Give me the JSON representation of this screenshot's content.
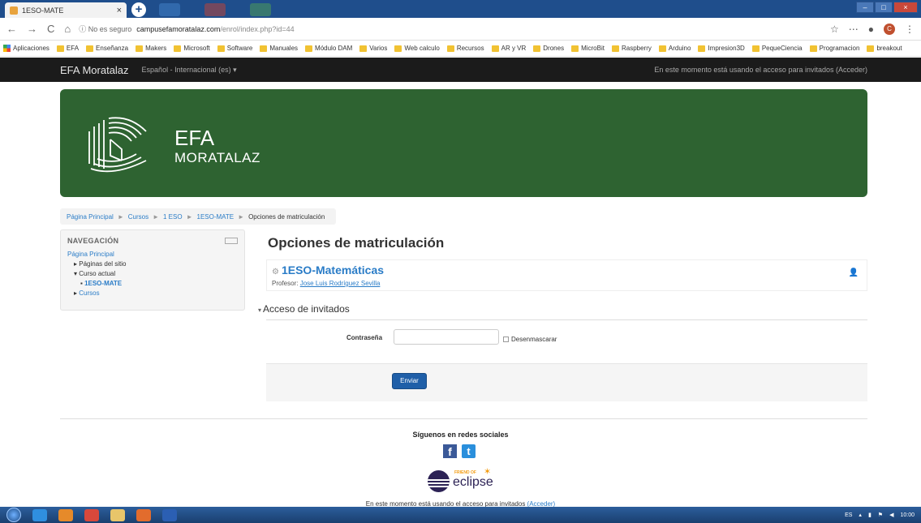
{
  "browser": {
    "tab_title": "1ESO-MATE",
    "tab_close": "×",
    "new_tab": "+",
    "nav_back": "←",
    "nav_forward": "→",
    "nav_reload": "C",
    "nav_home": "⌂",
    "security": "ⓘ No es seguro",
    "url_host": "campusefamoratalaz.com",
    "url_path": "/enrol/index.php?id=44",
    "profile_initial": "C",
    "bookmarks": [
      "Aplicaciones",
      "EFA",
      "Enseñanza",
      "Makers",
      "Microsoft",
      "Software",
      "Manuales",
      "Módulo DAM",
      "Varios",
      "Web calculo",
      "Recursos",
      "AR y VR",
      "Drones",
      "MicroBit",
      "Raspberry",
      "Arduino",
      "Impresion3D",
      "PequeCiencia",
      "Programacion",
      "breakout"
    ]
  },
  "topbar": {
    "brand": "EFA Moratalaz",
    "language": "Español - Internacional (es) ▾",
    "login_status": "En este momento está usando el acceso para invitados (Acceder)"
  },
  "banner": {
    "line1": "EFA",
    "line2": "MORATALAZ"
  },
  "breadcrumb": {
    "items": [
      "Página Principal",
      "Cursos",
      "1 ESO",
      "1ESO-MATE"
    ],
    "current": "Opciones de matriculación",
    "sep": "►"
  },
  "navigation": {
    "heading": "NAVEGACIÓN",
    "home": "Página Principal",
    "site_pages": "Páginas del sitio",
    "current_course": "Curso actual",
    "course": "1ESO-MATE",
    "courses": "Cursos"
  },
  "main": {
    "title": "Opciones de matriculación",
    "course_name": "1ESO-Matemáticas",
    "teacher_label": "Profesor:",
    "teacher_name": "Jose Luis Rodríguez Sevilla",
    "section": "Acceso de invitados",
    "password_label": "Contraseña",
    "unmask_label": "Desenmascarar",
    "submit": "Enviar"
  },
  "footer": {
    "follow": "Síguenos en redes sociales",
    "eclipse_friend": "FRIEND OF",
    "eclipse_word": "eclipse",
    "note": "En este momento está usando el acceso para invitados",
    "login_link": "(Acceder)"
  },
  "taskbar": {
    "lang": "ES",
    "time": "10:00"
  },
  "colors": {
    "banner": "#2e6331",
    "link": "#2a7cc7",
    "topbar": "#1b1b1b",
    "button": "#1f5fa8"
  }
}
